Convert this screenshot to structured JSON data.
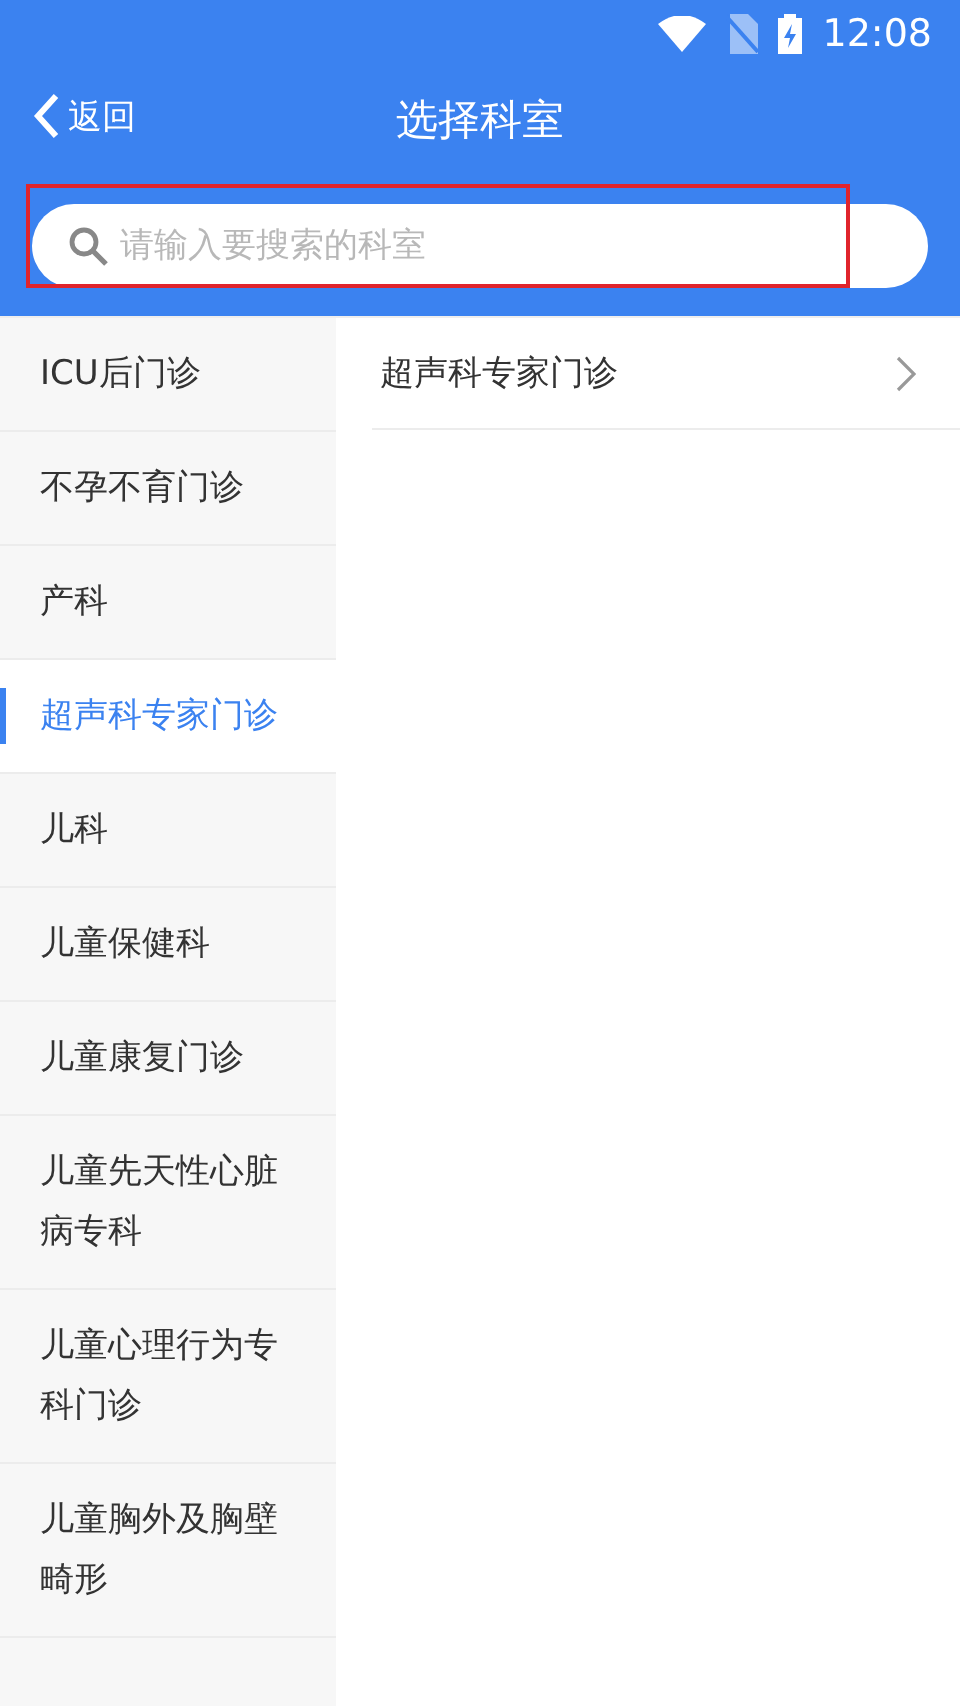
{
  "status_bar": {
    "time": "12:08"
  },
  "header": {
    "back": "返回",
    "title": "选择科室"
  },
  "search": {
    "placeholder": "请输入要搜索的科室"
  },
  "departments": [
    {
      "name": "ICU后门诊",
      "selected": false
    },
    {
      "name": "不孕不育门诊",
      "selected": false
    },
    {
      "name": "产科",
      "selected": false
    },
    {
      "name": "超声科专家门诊",
      "selected": true
    },
    {
      "name": "儿科",
      "selected": false
    },
    {
      "name": "儿童保健科",
      "selected": false
    },
    {
      "name": "儿童康复门诊",
      "selected": false
    },
    {
      "name": "儿童先天性心脏病专科",
      "selected": false
    },
    {
      "name": "儿童心理行为专科门诊",
      "selected": false
    },
    {
      "name": "儿童胸外及胸壁畸形",
      "selected": false
    }
  ],
  "clinics": [
    {
      "name": "超声科专家门诊"
    }
  ]
}
